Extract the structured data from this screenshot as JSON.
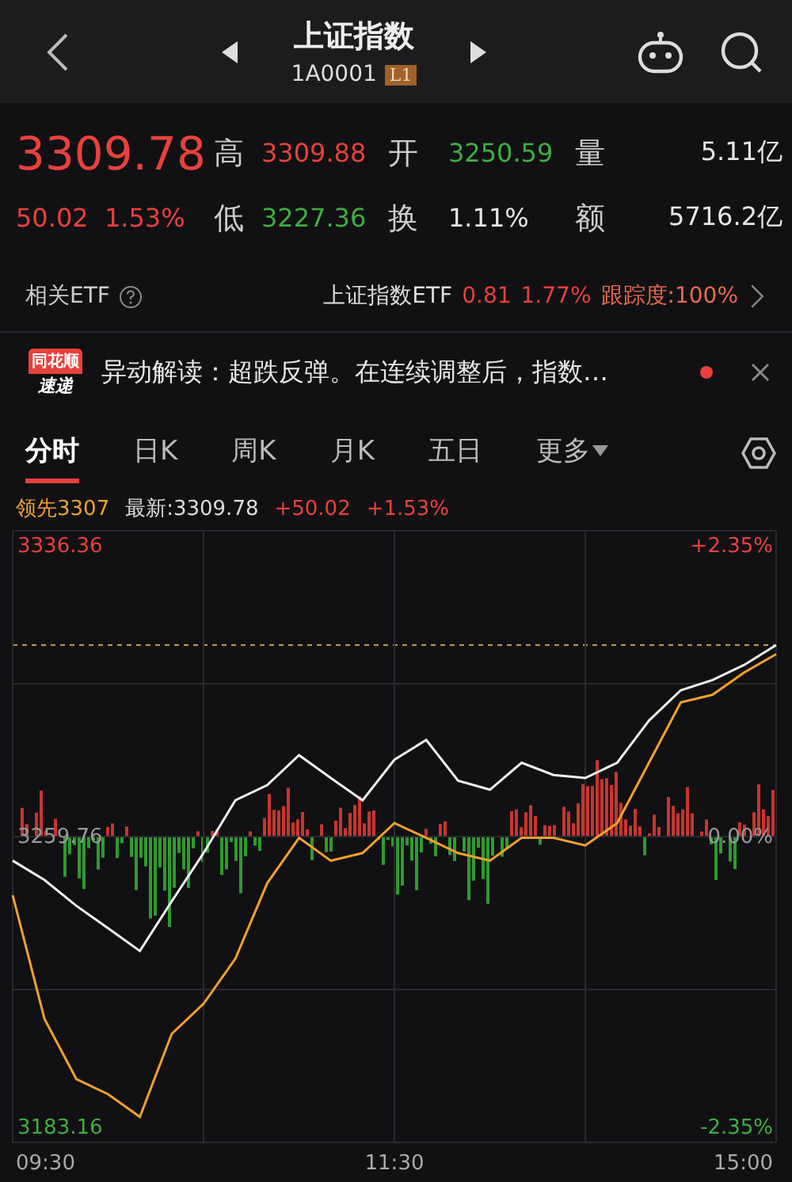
{
  "header": {
    "title": "上证指数",
    "code": "1A0001",
    "level_badge": "L1"
  },
  "quote": {
    "price": "3309.78",
    "change": "50.02",
    "change_pct": "1.53%",
    "stats": [
      {
        "label": "高",
        "value": "3309.88",
        "color": "#e8413c"
      },
      {
        "label": "开",
        "value": "3250.59",
        "color": "#3fae3f"
      },
      {
        "label": "量",
        "value": "5.11亿",
        "color": "#e6e6e6"
      },
      {
        "label": "低",
        "value": "3227.36",
        "color": "#3fae3f"
      },
      {
        "label": "换",
        "value": "1.11%",
        "color": "#e6e6e6"
      },
      {
        "label": "额",
        "value": "5716.2亿",
        "color": "#e6e6e6"
      }
    ]
  },
  "etf": {
    "label": "相关ETF",
    "name": "上证指数ETF",
    "price": "0.81",
    "change_pct": "1.77%",
    "tracking": "跟踪度:100%"
  },
  "news": {
    "logo_top": "同花顺",
    "logo_bottom": "速递",
    "text": "异动解读：超跌反弹。在连续调整后，指数…",
    "unread": true
  },
  "tabs": [
    {
      "label": "分时",
      "selected": true,
      "kind": "plain"
    },
    {
      "label": "日K",
      "selected": false,
      "kind": "plain"
    },
    {
      "label": "周K",
      "selected": false,
      "kind": "plain"
    },
    {
      "label": "月K",
      "selected": false,
      "kind": "plain"
    },
    {
      "label": "五日",
      "selected": false,
      "kind": "plain"
    },
    {
      "label": "更多",
      "selected": false,
      "kind": "dropdown"
    }
  ],
  "legend": {
    "lead": "领先3307",
    "latest": "最新:3309.78",
    "change": "+50.02",
    "change_pct": "+1.53%"
  },
  "chart": {
    "right_labels": [
      "+2.35%",
      "0.00%",
      "-2.35%"
    ],
    "time_labels": [
      "09:30",
      "11:30",
      "15:00"
    ],
    "chart_data": {
      "type": "line",
      "grid": true,
      "ylim": [
        3178.8,
        3339.9
      ],
      "yticks": [
        {
          "value": 3336.36,
          "label": "3336.36"
        },
        {
          "value": 3259.76,
          "label": "3259.76"
        },
        {
          "value": 3183.16,
          "label": "3183.16"
        }
      ],
      "series": [
        {
          "color": "#f0f0f0",
          "values": [
            3253.0,
            3247.9,
            3241.1,
            3235.2,
            3229.2,
            3242.3,
            3255.0,
            3268.9,
            3272.9,
            3280.8,
            3274.8,
            3268.9,
            3279.6,
            3284.8,
            3274.1,
            3271.7,
            3278.8,
            3275.6,
            3274.8,
            3278.8,
            3289.9,
            3297.9,
            3300.6,
            3304.6,
            3309.8
          ]
        },
        {
          "color": "#f0a030",
          "values": [
            3243.9,
            3211.3,
            3195.5,
            3191.5,
            3185.5,
            3207.4,
            3215.3,
            3227.2,
            3247.1,
            3259.0,
            3253.0,
            3255.0,
            3262.9,
            3259.0,
            3255.0,
            3253.0,
            3259.0,
            3259.0,
            3257.0,
            3262.9,
            3278.8,
            3294.7,
            3296.7,
            3302.6,
            3307.4
          ]
        }
      ]
    }
  }
}
